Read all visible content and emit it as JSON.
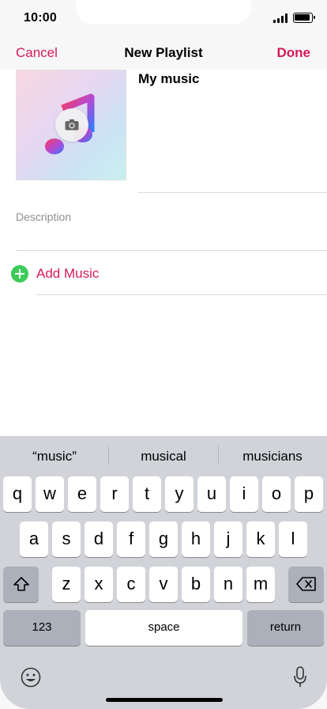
{
  "status_bar": {
    "time": "10:00"
  },
  "nav": {
    "cancel": "Cancel",
    "title": "New Playlist",
    "done": "Done"
  },
  "playlist": {
    "name": "My music",
    "description_placeholder": "Description"
  },
  "add_music": {
    "label": "Add Music"
  },
  "colors": {
    "accent": "#d6195a",
    "add_green": "#3ccb5a",
    "keyboard_bg": "#d1d3d9"
  },
  "keyboard": {
    "suggestions": [
      "“music”",
      "musical",
      "musicians"
    ],
    "row1": [
      "q",
      "w",
      "e",
      "r",
      "t",
      "y",
      "u",
      "i",
      "o",
      "p"
    ],
    "row2": [
      "a",
      "s",
      "d",
      "f",
      "g",
      "h",
      "j",
      "k",
      "l"
    ],
    "row3": [
      "z",
      "x",
      "c",
      "v",
      "b",
      "n",
      "m"
    ],
    "numbers_key": "123",
    "space_key": "space",
    "return_key": "return"
  }
}
